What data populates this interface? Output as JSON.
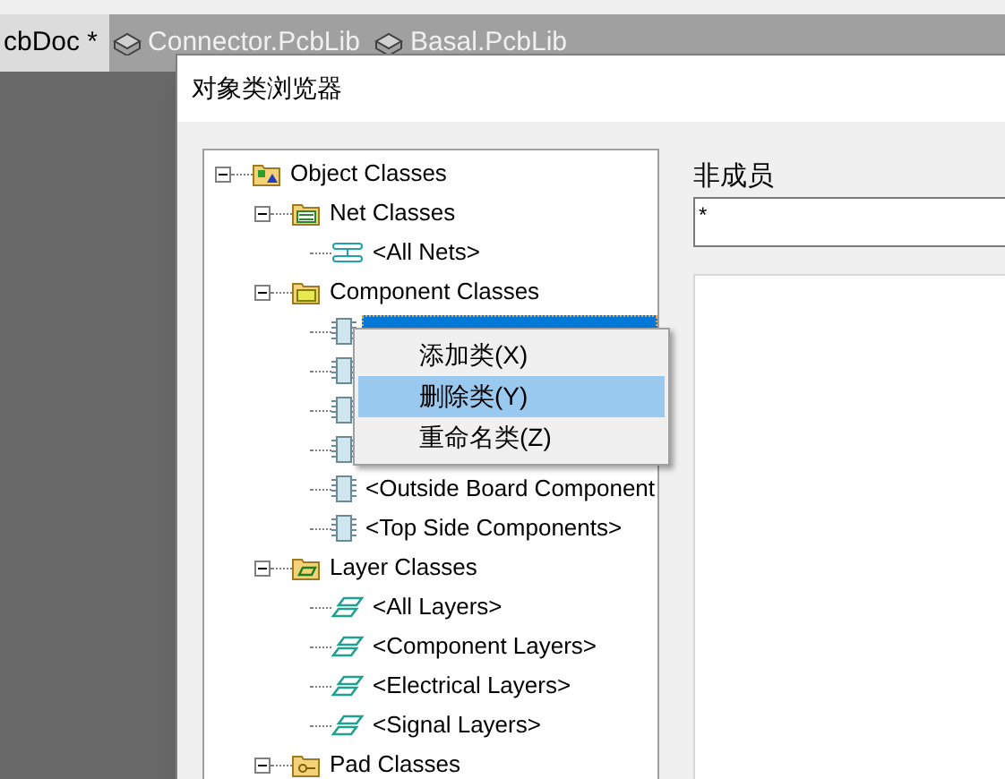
{
  "document_tabs": [
    {
      "label": "cbDoc *",
      "selected": true
    },
    {
      "label": "Connector.PcbLib",
      "selected": false
    },
    {
      "label": "Basal.PcbLib",
      "selected": false
    }
  ],
  "dialog": {
    "title": "对象类浏览器",
    "tree": [
      {
        "label": "Object Classes",
        "kind": "root",
        "expanded": true,
        "selected": false,
        "children": [
          {
            "label": "Net Classes",
            "kind": "net-folder",
            "expanded": true,
            "selected": false,
            "children": [
              {
                "label": "<All Nets>",
                "kind": "net",
                "selected": false
              }
            ]
          },
          {
            "label": "Component Classes",
            "kind": "component-folder",
            "expanded": true,
            "selected": false,
            "children": [
              {
                "kind": "component",
                "selected": true
              },
              {
                "kind": "component",
                "selected": false
              },
              {
                "kind": "component",
                "selected": false
              },
              {
                "kind": "component",
                "selected": false
              },
              {
                "label": "<Outside Board Component",
                "kind": "component",
                "selected": false
              },
              {
                "label": "<Top Side Components>",
                "kind": "component",
                "selected": false
              }
            ]
          },
          {
            "label": "Layer Classes",
            "kind": "layer-folder",
            "expanded": true,
            "selected": false,
            "children": [
              {
                "label": "<All Layers>",
                "kind": "layer",
                "selected": false
              },
              {
                "label": "<Component Layers>",
                "kind": "layer",
                "selected": false
              },
              {
                "label": "<Electrical Layers>",
                "kind": "layer",
                "selected": false
              },
              {
                "label": "<Signal Layers>",
                "kind": "layer",
                "selected": false
              }
            ]
          },
          {
            "label": "Pad Classes",
            "kind": "pad-folder",
            "expanded": true,
            "selected": false
          }
        ]
      }
    ],
    "non_members": {
      "label": "非成员",
      "value": "*"
    },
    "context_menu": [
      {
        "label": "添加类(X)",
        "selected": false
      },
      {
        "label": "删除类(Y)",
        "selected": true
      },
      {
        "label": "重命名类(Z)",
        "selected": false
      }
    ]
  }
}
